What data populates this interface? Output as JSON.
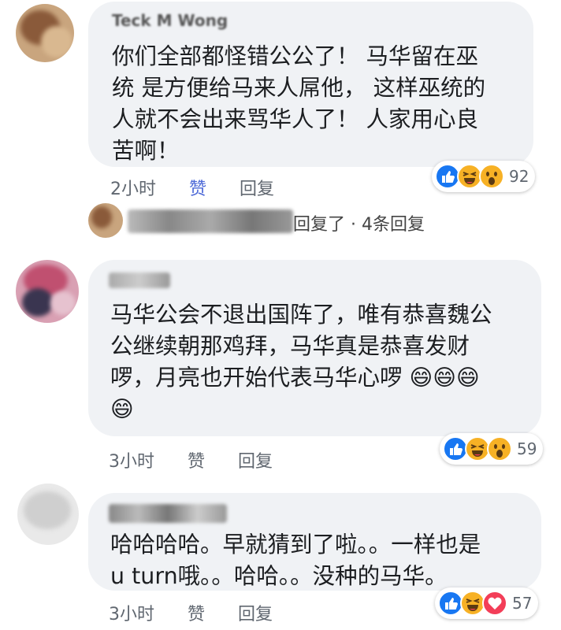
{
  "comments": [
    {
      "author": "Teck M Wong",
      "text": "你们全部都怪错公公了！ 马华留在巫统 是方便给马来人屌他， 这样巫统的人就不会出来骂华人了！ 人家用心良苦啊！",
      "text_lines": [
        "你们全部都怪错公公了！ 马华留在巫",
        "统 是方便给马来人屌他， 这样巫统的",
        "人就不会出来骂华人了！ 人家用心良",
        "苦啊！"
      ],
      "time": "2小时",
      "like_label": "赞",
      "reply_label": "回复",
      "reaction_count": "92",
      "reactions": [
        "like-icon",
        "haha-icon",
        "wow-icon"
      ],
      "replies_summary": "回复了 · 4条回复"
    },
    {
      "author": "",
      "text_lines": [
        "马华公会不退出国阵了，唯有恭喜魏公",
        "公继续朝那鸡拜，马华真是恭喜发财",
        "啰，月亮也开始代表马华心啰 😄😄😄",
        "😄"
      ],
      "time": "3小时",
      "like_label": "赞",
      "reply_label": "回复",
      "reaction_count": "59",
      "reactions": [
        "like-icon",
        "haha-icon",
        "wow-icon"
      ]
    },
    {
      "author": "",
      "text_lines": [
        "哈哈哈哈。早就猜到了啦。。一样也是",
        "u turn哦。。哈哈。。没种的马华。"
      ],
      "time": "3小时",
      "like_label": "赞",
      "reply_label": "回复",
      "reaction_count": "57",
      "reactions": [
        "like-icon",
        "haha-icon",
        "love-icon"
      ]
    }
  ],
  "colors": {
    "bubble": "#f0f2f5",
    "liked": "#4c68d7",
    "meta": "#606770",
    "like": "#1877f2",
    "haha": "#f7b125",
    "love": "#f33e58"
  }
}
